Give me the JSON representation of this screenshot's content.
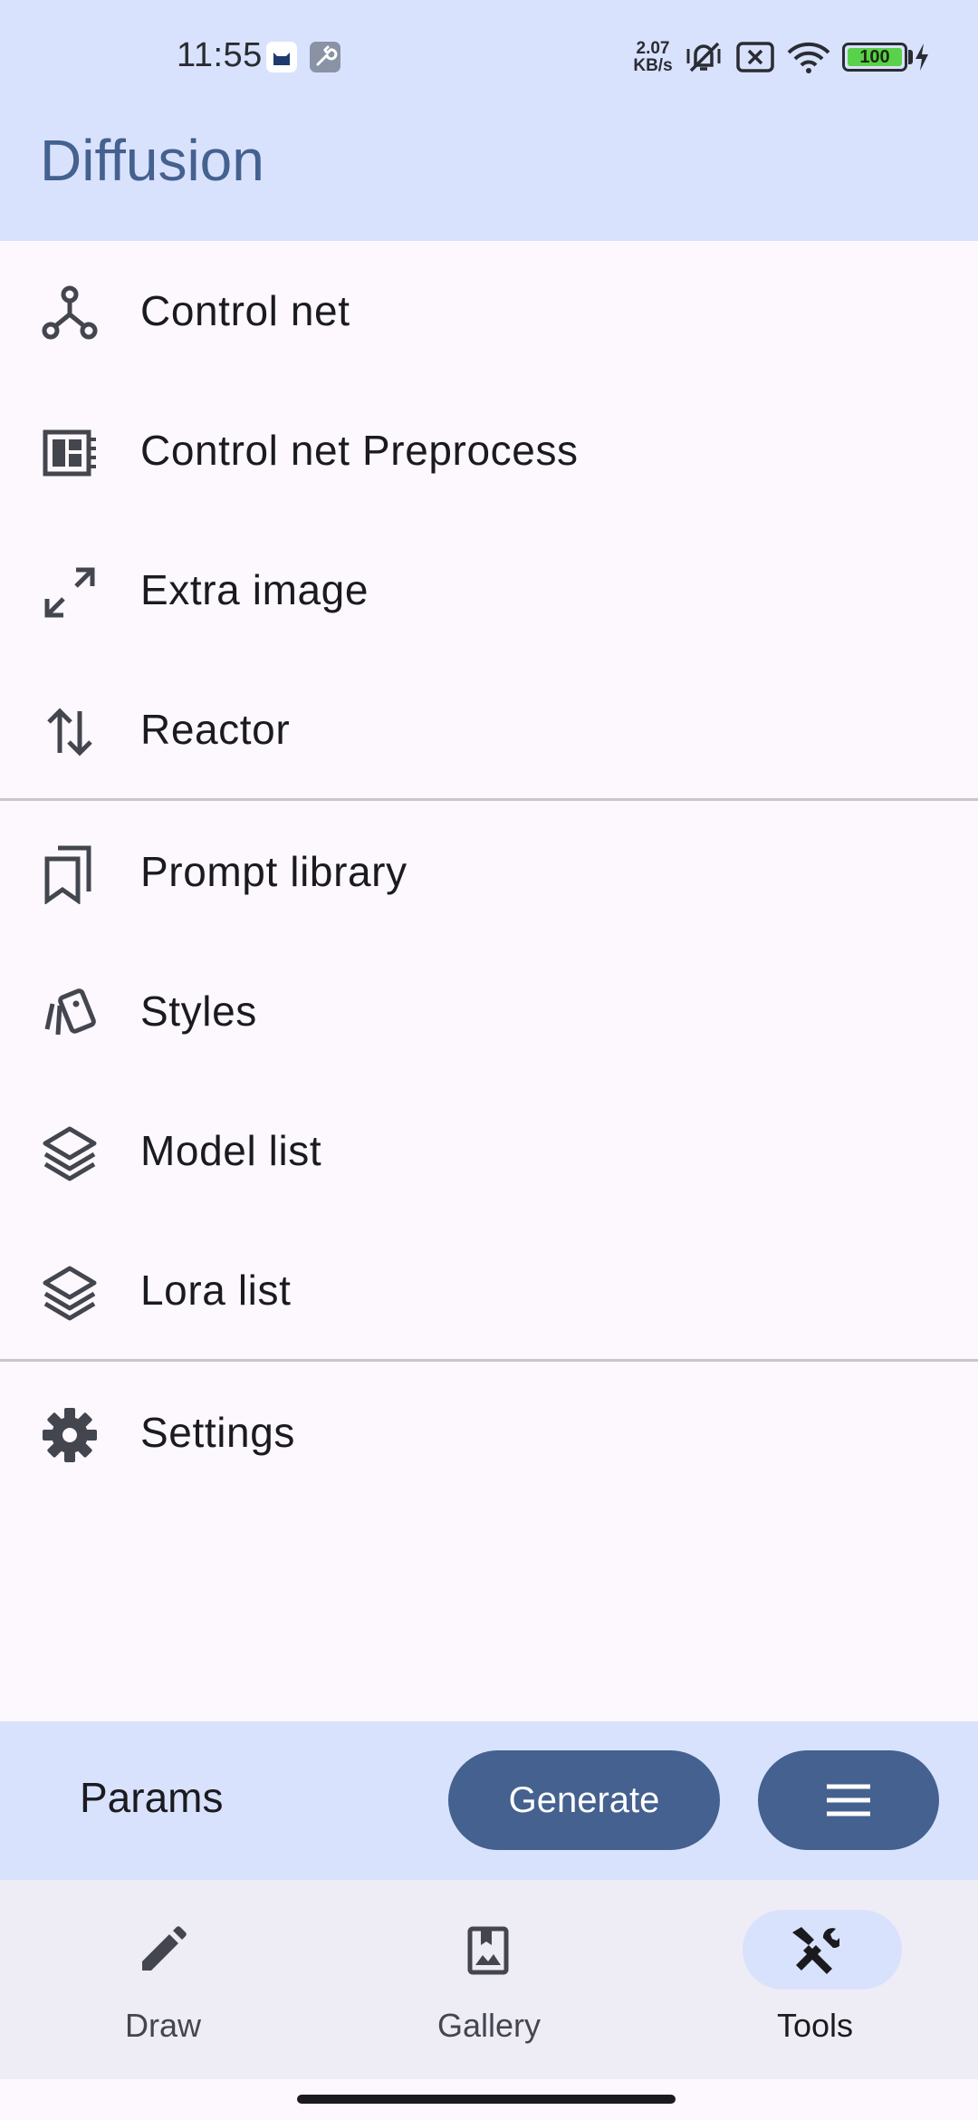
{
  "status_bar": {
    "time": "11:55",
    "net_speed_value": "2.07",
    "net_speed_unit": "KB/s",
    "battery_level": "100",
    "icons": [
      "app-cat-icon",
      "wrench-icon",
      "vibrate-off-icon",
      "sim-x-icon",
      "wifi-icon",
      "battery-icon",
      "charging-bolt-icon"
    ]
  },
  "header": {
    "title": "Diffusion"
  },
  "menu": {
    "group1": [
      {
        "label": "Control net",
        "icon": "control-net-icon"
      },
      {
        "label": "Control net Preprocess",
        "icon": "preprocess-icon"
      },
      {
        "label": "Extra image",
        "icon": "expand-icon"
      },
      {
        "label": "Reactor",
        "icon": "swap-vert-icon"
      }
    ],
    "group2": [
      {
        "label": "Prompt library",
        "icon": "bookmarks-icon"
      },
      {
        "label": "Styles",
        "icon": "styles-icon"
      },
      {
        "label": "Model list",
        "icon": "layers-icon"
      },
      {
        "label": "Lora list",
        "icon": "layers-icon"
      }
    ],
    "group3": [
      {
        "label": "Settings",
        "icon": "gear-icon"
      }
    ]
  },
  "action_bar": {
    "params_label": "Params",
    "generate_label": "Generate",
    "menu_icon": "hamburger-icon"
  },
  "nav": {
    "items": [
      {
        "label": "Draw",
        "icon": "pencil-icon",
        "active": false
      },
      {
        "label": "Gallery",
        "icon": "gallery-icon",
        "active": false
      },
      {
        "label": "Tools",
        "icon": "tools-icon",
        "active": true
      }
    ]
  },
  "colors": {
    "primary": "#44618F",
    "surface_tint": "#D9E2FD",
    "background": "#FCF8FD",
    "nav_background": "#EEECF5",
    "divider": "#C5C6D0"
  }
}
